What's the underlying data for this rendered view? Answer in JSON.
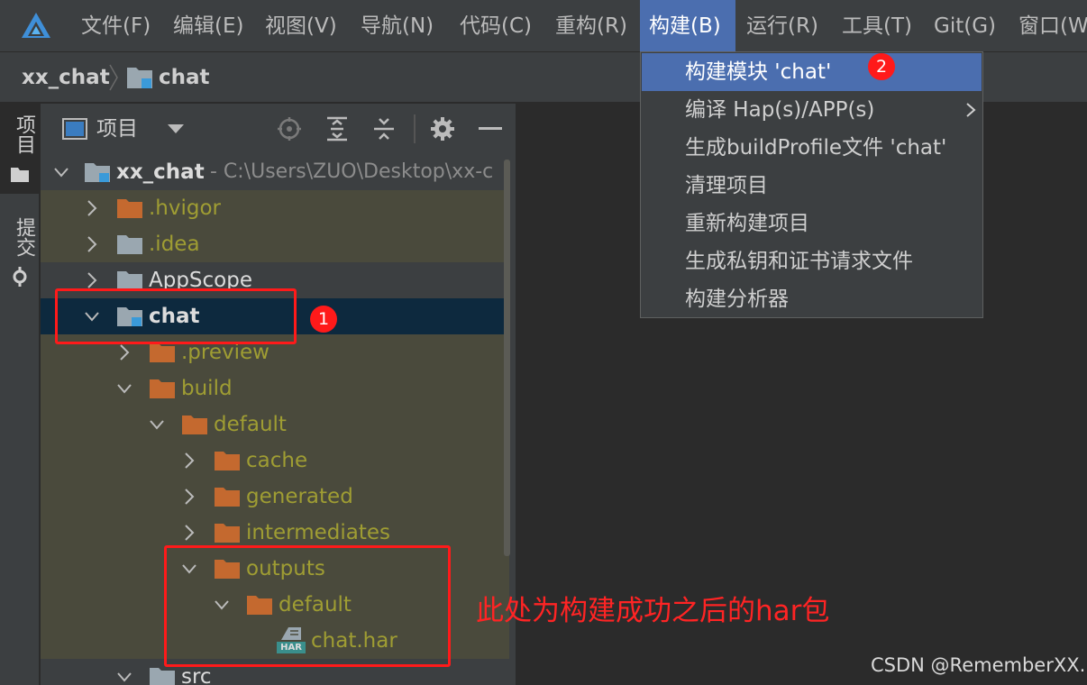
{
  "menubar": {
    "items": [
      "文件(F)",
      "编辑(E)",
      "视图(V)",
      "导航(N)",
      "代码(C)",
      "重构(R)",
      "构建(B)",
      "运行(R)",
      "工具(T)",
      "Git(G)",
      "窗口(W"
    ]
  },
  "breadcrumb": {
    "project": "xx_chat",
    "module": "chat"
  },
  "tool_strip": {
    "project_tab": "项目",
    "commit_tab": "提交"
  },
  "panel": {
    "title": "项目"
  },
  "tree": {
    "root_name": "xx_chat",
    "root_path": " - C:\\Users\\ZUO\\Desktop\\xx-c",
    "hvigor": ".hvigor",
    "idea": ".idea",
    "appscope": "AppScope",
    "chat": "chat",
    "preview": ".preview",
    "build": "build",
    "default": "default",
    "cache": "cache",
    "generated": "generated",
    "intermediates": "intermediates",
    "outputs": "outputs",
    "outputs_default": "default",
    "har_file": "chat.har",
    "har_icon_text": "HAR",
    "src": "src"
  },
  "dropdown": {
    "items": [
      "构建模块 'chat'",
      "编译 Hap(s)/APP(s)",
      "生成buildProfile文件 'chat'",
      "清理项目",
      "重新构建项目",
      "生成私钥和证书请求文件",
      "构建分析器"
    ]
  },
  "annotations": {
    "badge1": "1",
    "badge2": "2",
    "note": "此处为构建成功之后的har包",
    "watermark": "CSDN @RememberXX."
  },
  "colors": {
    "menu_active": "#4b6eaf",
    "selection": "#0d293e",
    "folder_orange": "#c4692f",
    "annotation_red": "#ff1a1a",
    "module_marker": "#3a9ad9"
  }
}
